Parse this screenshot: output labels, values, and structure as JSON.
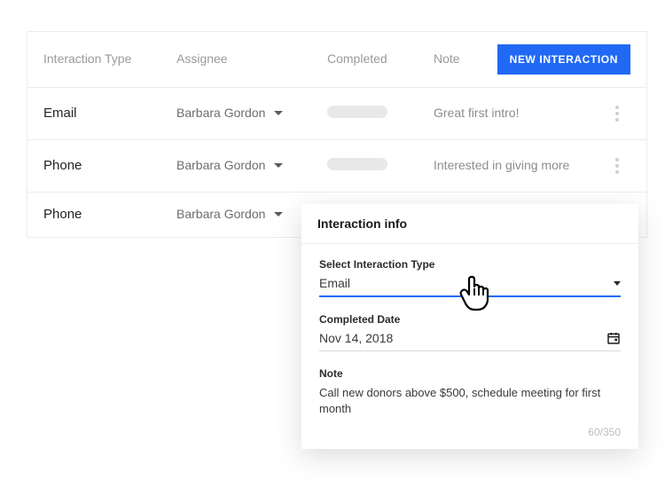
{
  "table": {
    "headers": {
      "type": "Interaction Type",
      "assignee": "Assignee",
      "completed": "Completed",
      "note": "Note"
    },
    "new_button": "NEW INTERACTION",
    "rows": [
      {
        "type": "Email",
        "assignee": "Barbara Gordon",
        "note": "Great first intro!"
      },
      {
        "type": "Phone",
        "assignee": "Barbara Gordon",
        "note": "Interested in giving more"
      },
      {
        "type": "Phone",
        "assignee": "Barbara Gordon",
        "note": ""
      }
    ]
  },
  "panel": {
    "title": "Interaction info",
    "type_label": "Select Interaction Type",
    "type_value": "Email",
    "date_label": "Completed Date",
    "date_value": "Nov 14, 2018",
    "note_label": "Note",
    "note_value": "Call new donors above $500, schedule meeting for first month",
    "char_count": "60/350"
  }
}
